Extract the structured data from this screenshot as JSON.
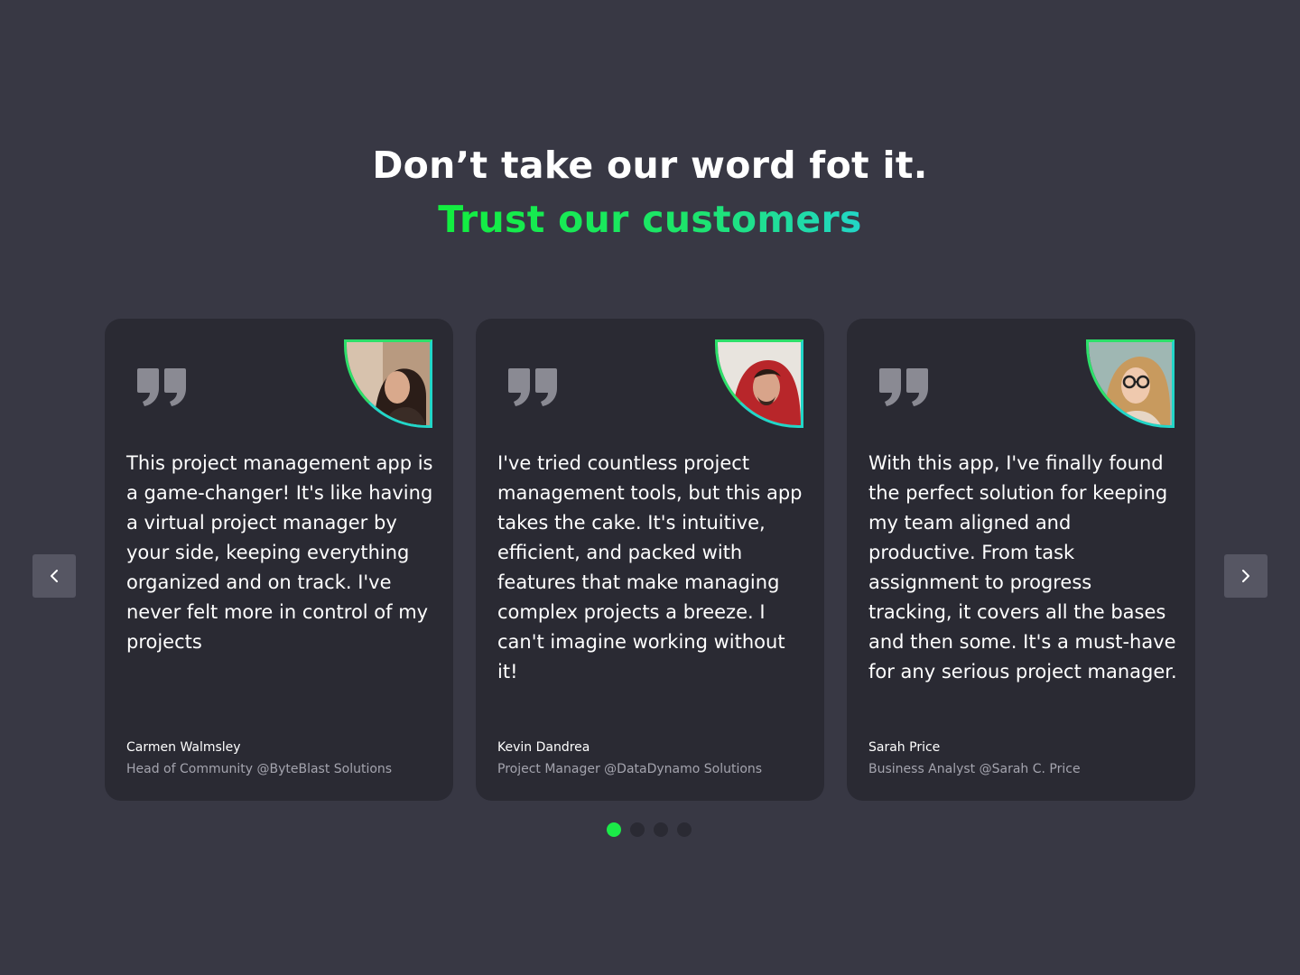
{
  "header": {
    "title": "Don’t  take our word fot it.",
    "subtitle": "Trust our customers"
  },
  "testimonials": [
    {
      "quote": "This project management app is a game-changer! It's like having a virtual project manager by your side, keeping everything organized and on track. I've never felt more in control of my projects",
      "name": "Carmen Walmsley",
      "role": "Head of Community @ByteBlast Solutions",
      "avatar_icon": "woman-portrait"
    },
    {
      "quote": "I've tried countless project management tools, but this app takes the cake. It's intuitive, efficient, and packed with features that make managing complex projects a breeze. I can't imagine working without it!",
      "name": "Kevin Dandrea",
      "role": "Project Manager @DataDynamo Solutions",
      "avatar_icon": "man-red-hoodie-portrait"
    },
    {
      "quote": "With this app, I've finally found the perfect solution for keeping my team aligned and productive. From task assignment to progress tracking, it covers all the bases and then some. It's a must-have for any serious project manager.",
      "name": "Sarah Price",
      "role": "Business Analyst @Sarah C. Price",
      "avatar_icon": "woman-glasses-portrait"
    }
  ],
  "carousel": {
    "prev_icon": "chevron-left-icon",
    "next_icon": "chevron-right-icon",
    "page_count": 4,
    "active_page": 1
  },
  "colors": {
    "background": "#383844",
    "card": "#2a2a33",
    "accent_green": "#1bea48",
    "accent_teal": "#22d6c8",
    "quote_icon": "#8a8a93",
    "muted_text": "#a4a4ae"
  }
}
